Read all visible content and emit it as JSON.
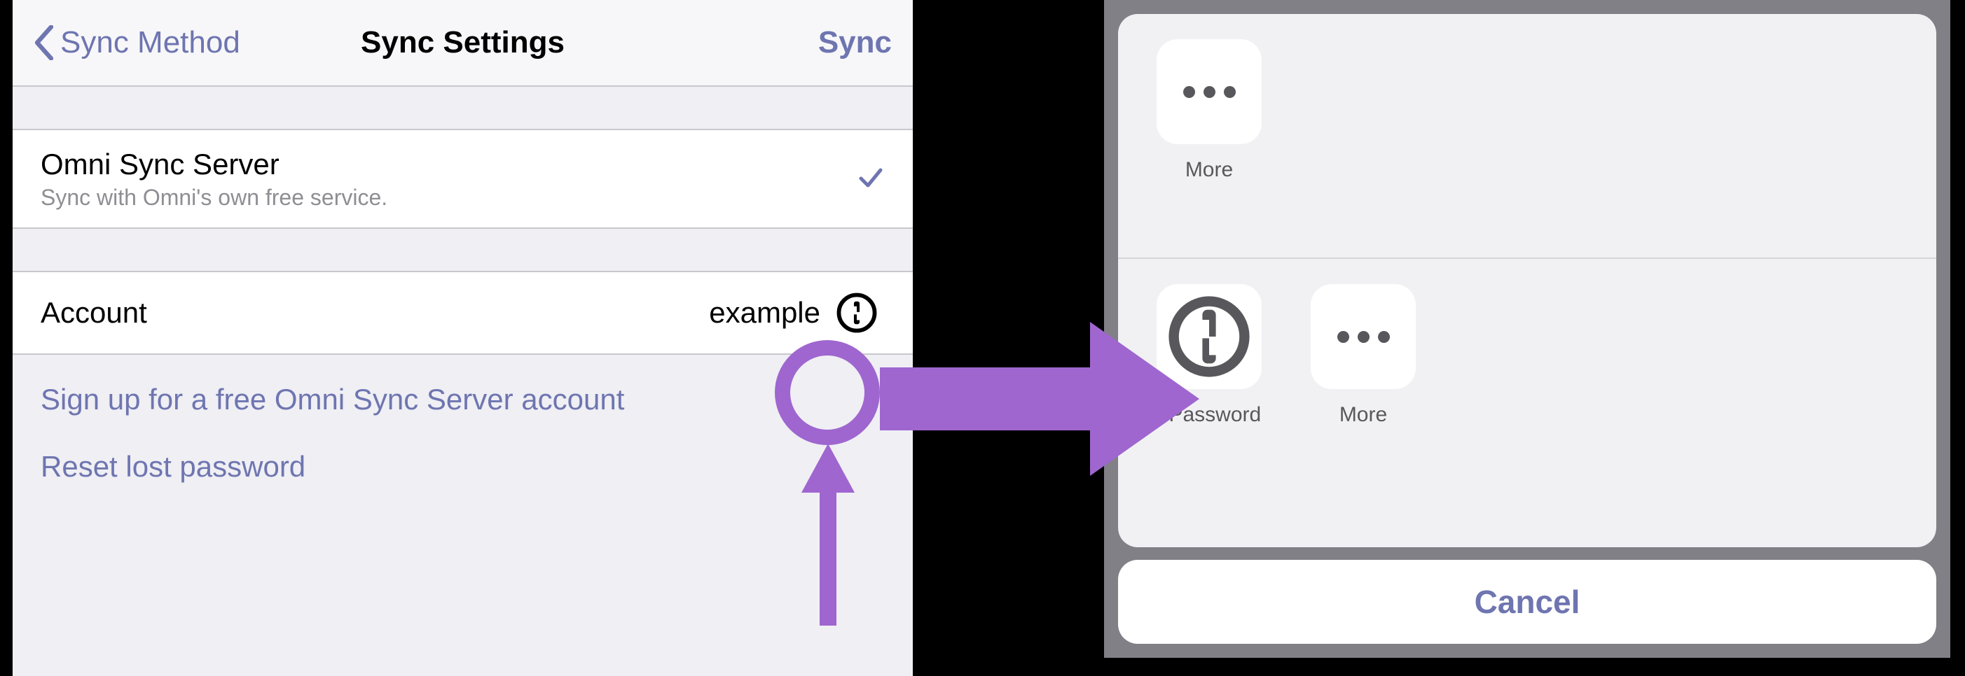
{
  "nav": {
    "back_label": "Sync Method",
    "title": "Sync Settings",
    "action": "Sync"
  },
  "server_cell": {
    "title": "Omni Sync Server",
    "subtitle": "Sync with Omni's own free service."
  },
  "account_cell": {
    "label": "Account",
    "value": "example"
  },
  "links": {
    "signup": "Sign up for a free Omni Sync Server account",
    "reset": "Reset lost password"
  },
  "share_sheet": {
    "row1": {
      "more": "More"
    },
    "row2": {
      "onepassword": "1Password",
      "more": "More"
    },
    "cancel": "Cancel"
  },
  "colors": {
    "accent": "#6e75b0",
    "annotation": "#9f66cf"
  }
}
